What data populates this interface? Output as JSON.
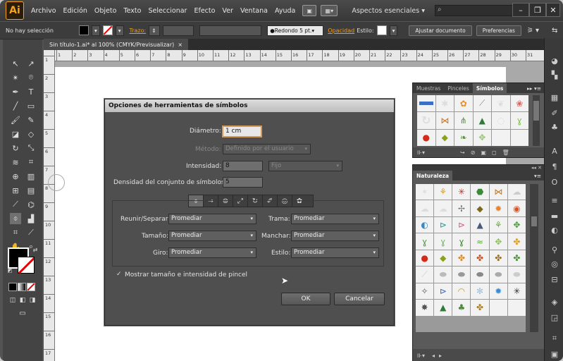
{
  "app": {
    "logo": "Ai",
    "menu": [
      "Archivo",
      "Edición",
      "Objeto",
      "Texto",
      "Seleccionar",
      "Efecto",
      "Ver",
      "Ventana",
      "Ayuda"
    ],
    "workspace": "Aspectos esenciales",
    "search_placeholder": ""
  },
  "control_bar": {
    "selection": "No hay selección",
    "stroke_label": "Trazo:",
    "brush": "Redondo 5 pt.",
    "opacity_label": "Opacidad",
    "style_label": "Estilo:",
    "adjust_doc": "Ajustar documento",
    "prefs": "Preferencias"
  },
  "document": {
    "tab_title": "Sin título-1.ai* al 100% (CMYK/Previsualizar)",
    "close": "×"
  },
  "rulers": {
    "h_labels": [
      "1",
      "2",
      "3",
      "4",
      "5",
      "6",
      "7",
      "8",
      "9",
      "10",
      "11",
      "12",
      "13",
      "14",
      "15",
      "16",
      "17",
      "18",
      "19",
      "20",
      "21",
      "22",
      "23",
      "24",
      "25",
      "26",
      "27",
      "28",
      "29",
      "30",
      "31"
    ],
    "v_labels": [
      "1",
      "2",
      "3",
      "4",
      "5",
      "6",
      "7",
      "8",
      "9",
      "10",
      "11",
      "12",
      "13",
      "14",
      "15",
      "16",
      "17"
    ]
  },
  "dialog": {
    "title": "Opciones de herramientas de símbolos",
    "diametro_label": "Diámetro:",
    "diametro_value": "1 cm",
    "metodo_label": "Método:",
    "metodo_value": "Definido por el usuario",
    "intensidad_label": "Intensidad:",
    "intensidad_value": "8",
    "intensidad_mode": "Fijo",
    "densidad_label": "Densidad del conjunto de símbolos:",
    "densidad_value": "5",
    "reunir_label": "Reunir/Separar:",
    "reunir_value": "Promediar",
    "tamano_label": "Tamaño:",
    "tamano_value": "Promediar",
    "giro_label": "Giro:",
    "giro_value": "Promediar",
    "trama_label": "Trama:",
    "trama_value": "Promediar",
    "manchar_label": "Manchar:",
    "manchar_value": "Promediar",
    "estilo_label": "Estilo:",
    "estilo_value": "Promediar",
    "show_brush_label": "Mostrar tamaño e intensidad de pincel",
    "ok": "OK",
    "cancel": "Cancelar"
  },
  "symbols_panel": {
    "tabs": [
      "Muestras",
      "Pinceles",
      "Símbolos"
    ]
  },
  "naturaleza_panel": {
    "title": "Naturaleza"
  },
  "colors": {
    "accent": "#f29f1c",
    "field_focus": "#d49a58"
  }
}
